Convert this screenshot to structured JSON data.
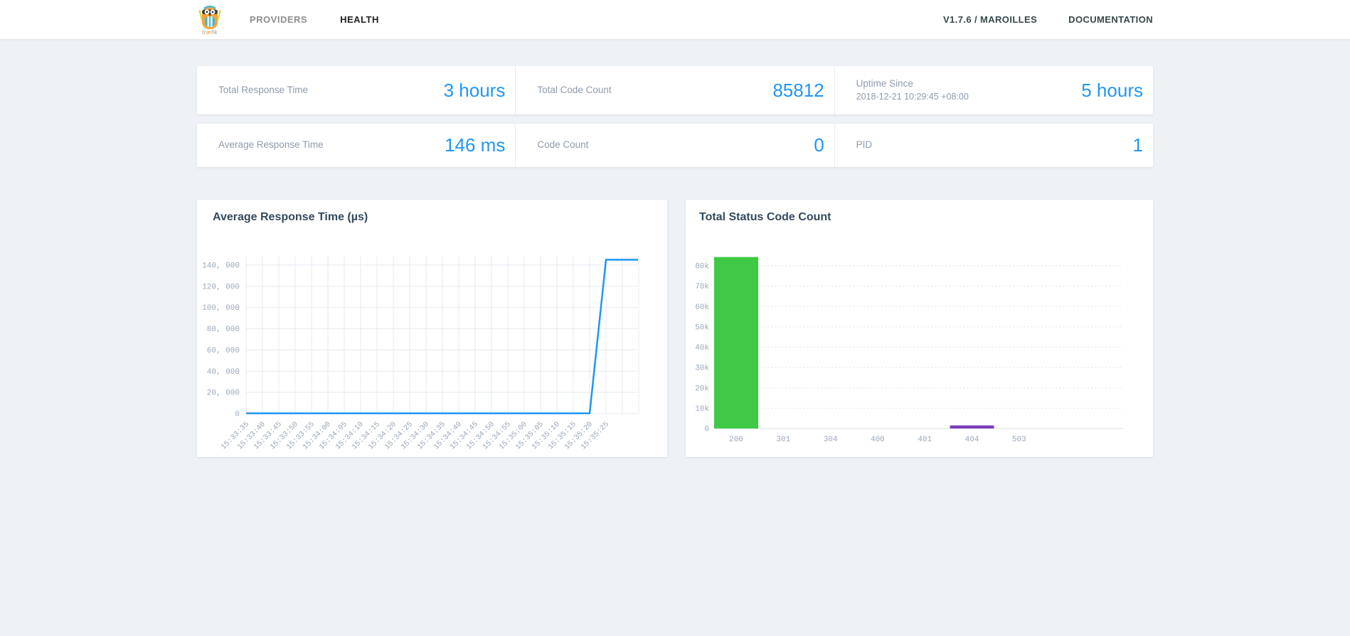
{
  "navbar": {
    "logo_text": "træfik",
    "items": [
      {
        "label": "PROVIDERS",
        "active": false
      },
      {
        "label": "HEALTH",
        "active": true
      }
    ],
    "right_items": [
      {
        "label": "V1.7.6 / MAROILLES"
      },
      {
        "label": "DOCUMENTATION"
      }
    ]
  },
  "stats_rows": [
    {
      "cells": [
        {
          "label": "Total Response Time",
          "value": "3 hours"
        },
        {
          "label": "Total Code Count",
          "value": "85812"
        },
        {
          "label": "Uptime Since",
          "sublabel": "2018-12-21 10:29:45 +08:00",
          "value": "5 hours"
        }
      ]
    },
    {
      "cells": [
        {
          "label": "Average Response Time",
          "value": "146 ms"
        },
        {
          "label": "Code Count",
          "value": "0"
        },
        {
          "label": "PID",
          "value": "1"
        }
      ]
    }
  ],
  "colors": {
    "accent_blue": "#2196f3",
    "line_blue": "#1e96f0",
    "bar_green": "#3ec946",
    "bar_purple": "#7b3db8",
    "grid": "#e5eaf0",
    "grid_dotted": "#dfe4ea",
    "axis_text": "#9aa7b8"
  },
  "chart_data": [
    {
      "type": "line",
      "title": "Average Response Time (µs)",
      "x": [
        "15:33:35",
        "15:33:40",
        "15:33:45",
        "15:33:50",
        "15:33:55",
        "15:34:00",
        "15:34:05",
        "15:34:10",
        "15:34:15",
        "15:34:20",
        "15:34:25",
        "15:34:30",
        "15:34:35",
        "15:34:40",
        "15:34:45",
        "15:34:50",
        "15:34:55",
        "15:35:00",
        "15:35:05",
        "15:35:10",
        "15:35:15",
        "15:35:20",
        "15:35:25"
      ],
      "values": [
        150,
        150,
        150,
        150,
        150,
        150,
        150,
        150,
        150,
        150,
        150,
        150,
        150,
        150,
        150,
        150,
        150,
        150,
        150,
        150,
        150,
        150,
        145000
      ],
      "y_tick_values": [
        0,
        20000,
        40000,
        60000,
        80000,
        100000,
        120000,
        140000
      ],
      "y_tick_labels": [
        "0",
        "20, 000",
        "40, 000",
        "60, 000",
        "80, 000",
        "100, 000",
        "120, 000",
        "140, 000"
      ],
      "ylim": [
        0,
        148000
      ],
      "grid": "full",
      "line_color": "#1e96f0",
      "extend_last_value_to_right_edge": true
    },
    {
      "type": "bar",
      "title": "Total Status Code Count",
      "categories": [
        "200",
        "301",
        "304",
        "400",
        "401",
        "404",
        "503"
      ],
      "values": [
        84300,
        0,
        0,
        0,
        0,
        1512,
        0
      ],
      "bar_colors": [
        "#3ec946",
        "#3ec946",
        "#3ec946",
        "#3ec946",
        "#3ec946",
        "#7b3db8",
        "#3ec946"
      ],
      "y_tick_values": [
        0,
        10000,
        20000,
        30000,
        40000,
        50000,
        60000,
        70000,
        80000
      ],
      "y_tick_labels": [
        "0",
        "10k",
        "20k",
        "30k",
        "40k",
        "50k",
        "60k",
        "70k",
        "80k"
      ],
      "ylim": [
        0,
        85000
      ],
      "grid": "horizontal-dotted"
    }
  ]
}
